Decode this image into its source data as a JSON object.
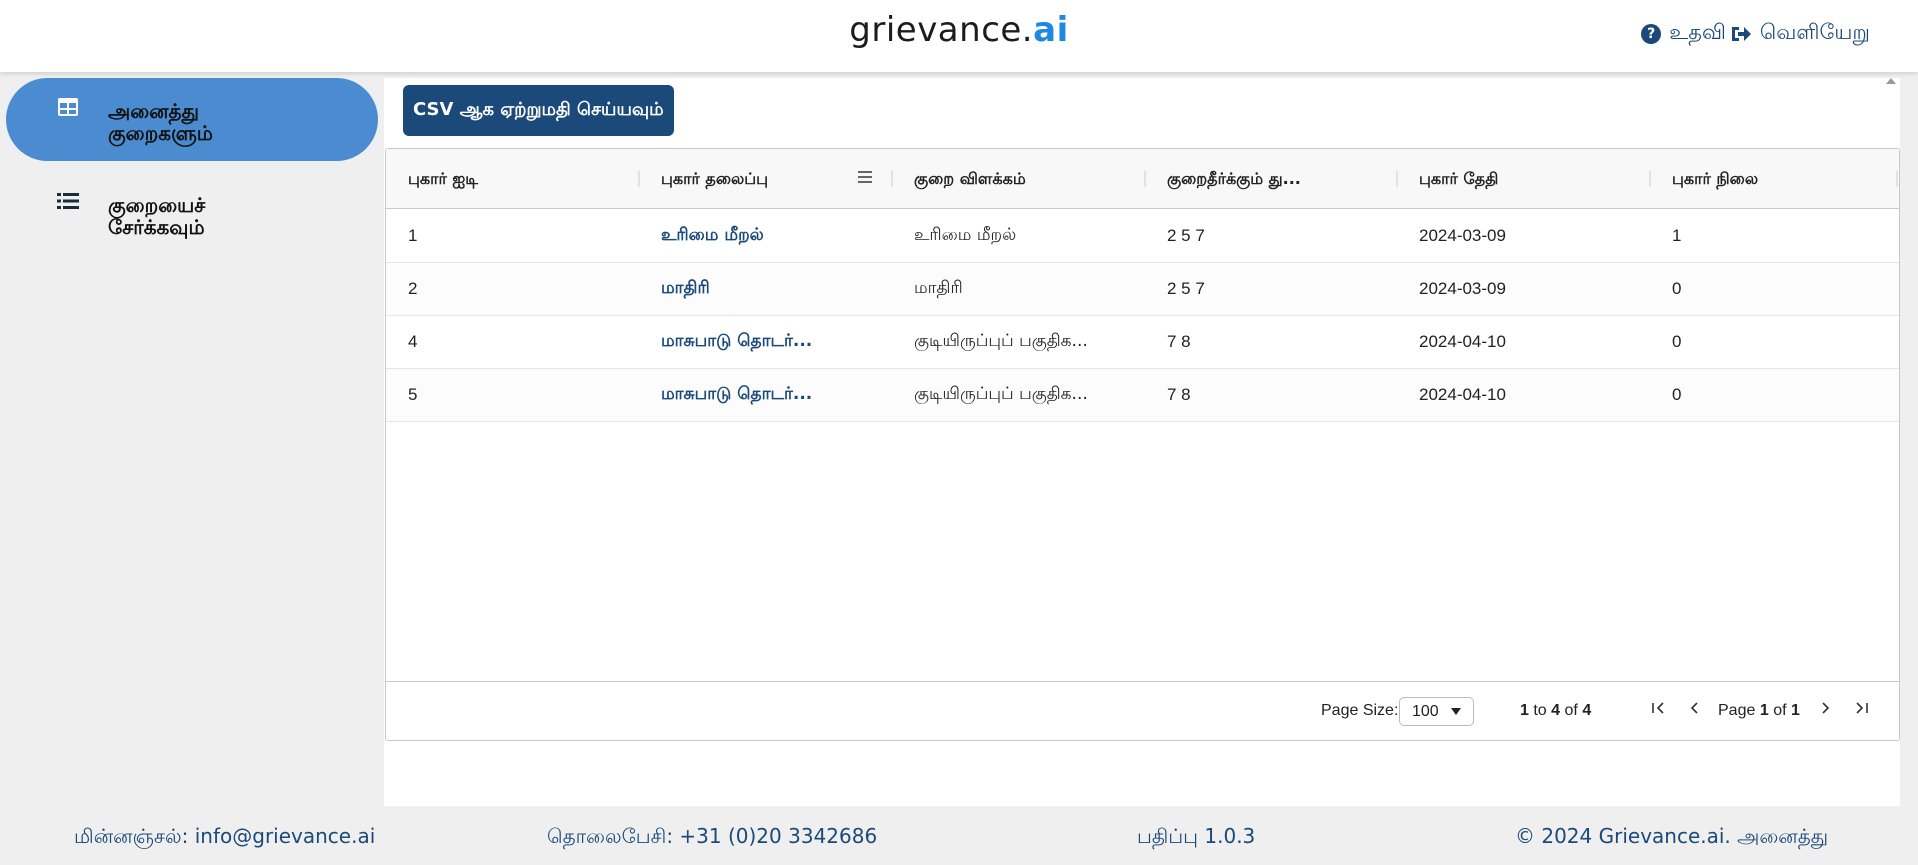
{
  "header": {
    "brand_main": "grievance.",
    "brand_accent": "ai",
    "help_label": "உதவி",
    "logout_label": "வெளியேறு"
  },
  "sidebar": {
    "items": [
      {
        "label": "அனைத்து குறைகளும்",
        "icon": "table-icon",
        "active": true
      },
      {
        "label": "குறையைச் சேர்க்கவும்",
        "icon": "list-icon",
        "active": false
      }
    ]
  },
  "toolbar": {
    "export_label": "CSV ஆக ஏற்றுமதி செய்யவும்"
  },
  "table": {
    "columns": [
      "புகார் ஐடி",
      "புகார் தலைப்பு",
      "குறை விளக்கம்",
      "குறைதீர்க்கும் து...",
      "புகார் தேதி",
      "புகார் நிலை"
    ],
    "rows": [
      [
        "1",
        "உரிமை மீறல்",
        "உரிமை மீறல்",
        "2 5 7",
        "2024-03-09",
        "1"
      ],
      [
        "2",
        "மாதிரி",
        "மாதிரி",
        "2 5 7",
        "2024-03-09",
        "0"
      ],
      [
        "4",
        "மாசுபாடு தொடர்...",
        "குடியிருப்புப் பகுதிக...",
        "7 8",
        "2024-04-10",
        "0"
      ],
      [
        "5",
        "மாசுபாடு தொடர்...",
        "குடியிருப்புப் பகுதிக...",
        "7 8",
        "2024-04-10",
        "0"
      ]
    ]
  },
  "pager": {
    "page_size_label": "Page Size:",
    "page_size_value": "100",
    "range_from": "1",
    "range_to_word": "to",
    "range_to": "4",
    "range_of_word": "of",
    "range_total": "4",
    "page_word": "Page",
    "page_current": "1",
    "page_of_word": "of",
    "page_total": "1"
  },
  "footer": {
    "email": "மின்னஞ்சல்: info@grievance.ai",
    "phone": "தொலைபேசி: +31 (0)20 3342686",
    "version": "பதிப்பு 1.0.3",
    "copyright": "© 2024 Grievance.ai. அனைத்து"
  },
  "colors": {
    "primary": "#1b4a7a",
    "accent": "#1e88e5",
    "sidebar_active": "#4a8ccf"
  }
}
